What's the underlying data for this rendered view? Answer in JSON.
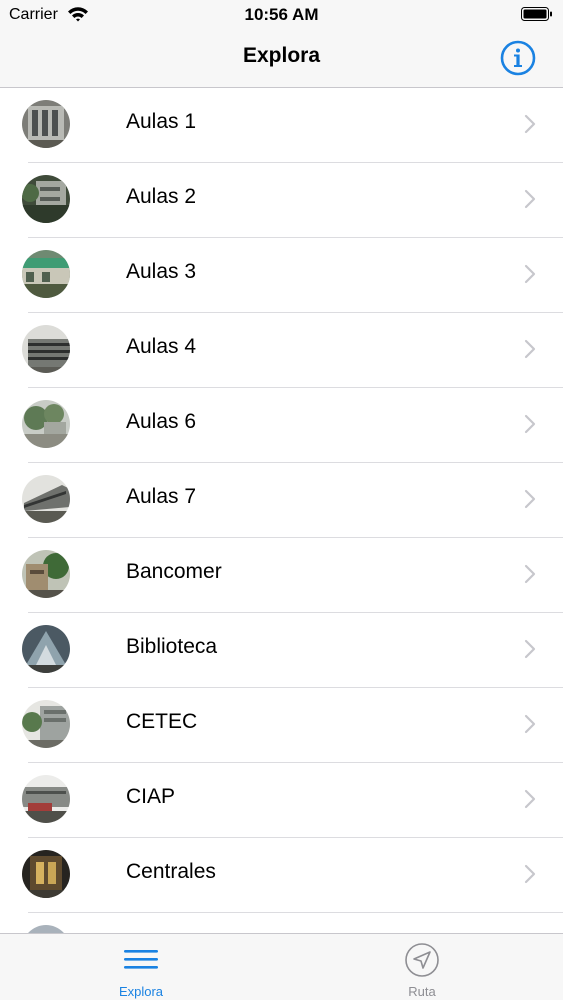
{
  "status_bar": {
    "carrier": "Carrier",
    "time": "10:56 AM"
  },
  "nav": {
    "title": "Explora",
    "info_icon": "info-circle-icon"
  },
  "list": {
    "items": [
      {
        "label": "Aulas 1"
      },
      {
        "label": "Aulas 2"
      },
      {
        "label": "Aulas 3"
      },
      {
        "label": "Aulas 4"
      },
      {
        "label": "Aulas 6"
      },
      {
        "label": "Aulas 7"
      },
      {
        "label": "Bancomer"
      },
      {
        "label": "Biblioteca"
      },
      {
        "label": "CETEC"
      },
      {
        "label": "CIAP"
      },
      {
        "label": "Centrales"
      },
      {
        "label": ""
      }
    ]
  },
  "tabs": [
    {
      "label": "Explora",
      "icon": "menu-lines-icon",
      "selected": true
    },
    {
      "label": "Ruta",
      "icon": "navigation-arrow-icon",
      "selected": false
    }
  ],
  "colors": {
    "accent": "#1a82e2",
    "inactive": "#8e8e93",
    "chevron": "#c7c7cc"
  }
}
